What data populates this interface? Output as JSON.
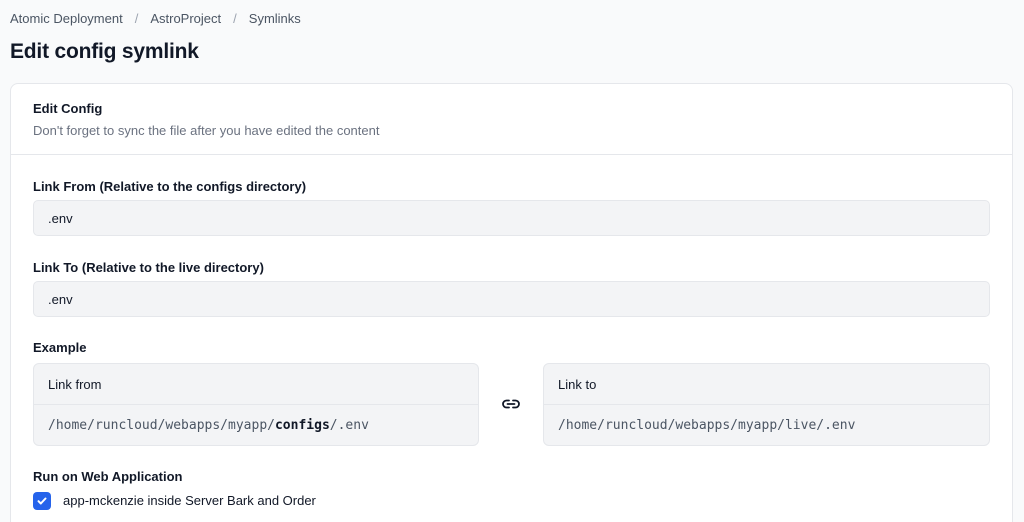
{
  "breadcrumb": {
    "items": [
      "Atomic Deployment",
      "AstroProject",
      "Symlinks"
    ],
    "separator": "/"
  },
  "page_title": "Edit config symlink",
  "card": {
    "title": "Edit Config",
    "subtitle": "Don't forget to sync the file after you have edited the content"
  },
  "link_from": {
    "label": "Link From (Relative to the configs directory)",
    "value": ".env"
  },
  "link_to": {
    "label": "Link To (Relative to the live directory)",
    "value": ".env"
  },
  "example": {
    "label": "Example",
    "from": {
      "header": "Link from",
      "path_prefix": "/home/runcloud/webapps/myapp/",
      "path_bold": "configs",
      "path_suffix": "/.env"
    },
    "to": {
      "header": "Link to",
      "path": "/home/runcloud/webapps/myapp/live/.env"
    }
  },
  "run_on": {
    "label": "Run on Web Application",
    "option_label": "app-mckenzie inside Server Bark and Order",
    "checked": true
  },
  "colors": {
    "accent": "#2563eb",
    "input_bg": "#f3f4f6",
    "border": "#e5e7eb"
  },
  "icons": {
    "link": "link-icon",
    "check": "check-icon"
  }
}
